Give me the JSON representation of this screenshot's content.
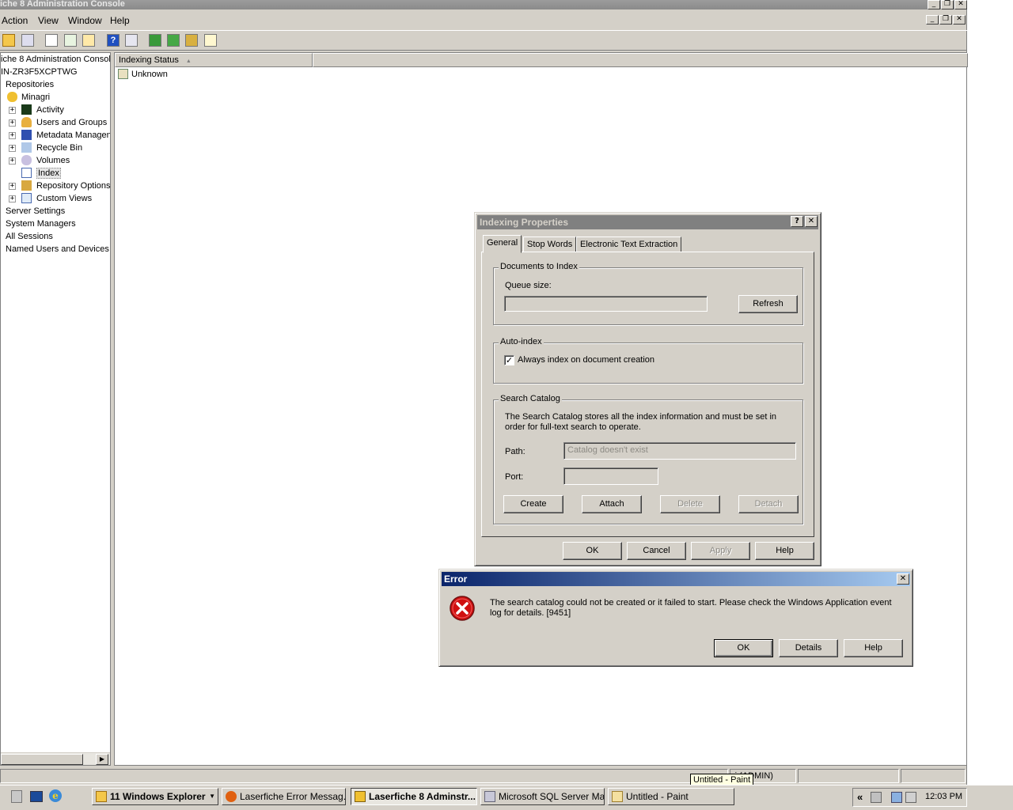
{
  "window": {
    "title": "iche 8 Administration Console"
  },
  "menubar": {
    "items": [
      "Action",
      "View",
      "Window",
      "Help"
    ]
  },
  "tree": {
    "root_label": "iche 8 Administration Console",
    "server_label": "IN-ZR3F5XCPTWG",
    "repositories_label": "Repositories",
    "repository_label": "Minagri",
    "repo_items": [
      "Activity",
      "Users and Groups",
      "Metadata Managen",
      "Recycle Bin",
      "Volumes",
      "Index",
      "Repository Options",
      "Custom Views"
    ],
    "server_items": [
      "Server Settings",
      "System Managers",
      "All Sessions",
      "Named Users and Devices"
    ]
  },
  "list": {
    "column_header": "Indexing Status",
    "rows": [
      "Unknown"
    ]
  },
  "statusbar": {
    "user_text": "ri (ADMIN)"
  },
  "tooltip": {
    "text": "Untitled - Paint"
  },
  "indexing_dialog": {
    "title": "Indexing Properties",
    "tabs": [
      "General",
      "Stop Words",
      "Electronic Text Extraction"
    ],
    "documents_group": "Documents to Index",
    "queue_label": "Queue size:",
    "queue_value": "",
    "refresh_label": "Refresh",
    "autoindex_group": "Auto-index",
    "autoindex_checkbox": "Always index on document creation",
    "autoindex_checked": true,
    "catalog_group": "Search Catalog",
    "catalog_desc": "The Search Catalog stores all the index information and must be set in order for full-text search to operate.",
    "path_label": "Path:",
    "path_value": "Catalog doesn't exist",
    "port_label": "Port:",
    "port_value": "",
    "create_label": "Create",
    "attach_label": "Attach",
    "delete_label": "Delete",
    "detach_label": "Detach",
    "ok_label": "OK",
    "cancel_label": "Cancel",
    "apply_label": "Apply",
    "help_label": "Help"
  },
  "error_dialog": {
    "title": "Error",
    "message": "The search catalog could not be created or it failed to start. Please check the Windows Application event log for details. [9451]",
    "ok_label": "OK",
    "details_label": "Details",
    "help_label": "Help"
  },
  "taskbar": {
    "tasks": [
      "11 Windows Explorer",
      "Laserfiche Error Messag...",
      "Laserfiche 8 Adminstr...",
      "Microsoft SQL Server Ma...",
      "Untitled - Paint"
    ],
    "tray_expand": "«",
    "clock": "12:03 PM"
  },
  "colors": {
    "error_titlebar_start": "#0a246a",
    "error_titlebar_end": "#a6caf0",
    "inactive_titlebar": "#808080"
  }
}
